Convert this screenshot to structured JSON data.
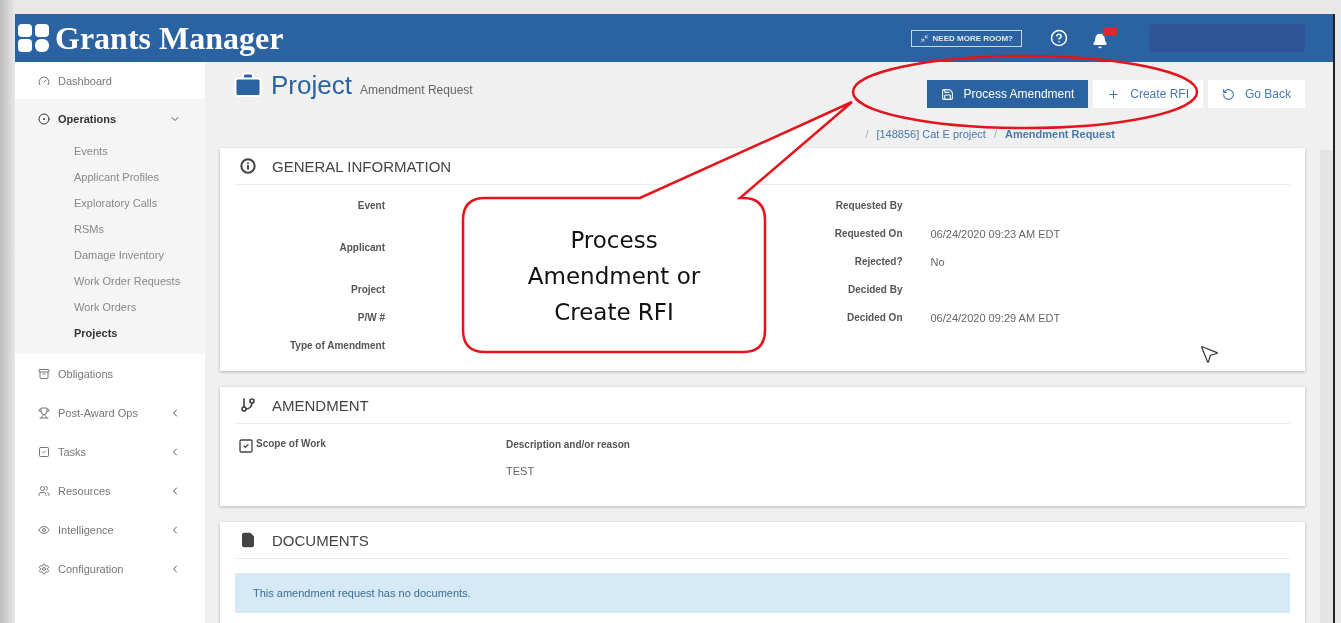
{
  "header": {
    "logo_text": "Grants Manager",
    "room_button": "NEED MORE ROOM?"
  },
  "sidebar": {
    "items": [
      {
        "label": "Dashboard",
        "selected": false
      },
      {
        "label": "Operations",
        "expanded": true,
        "selected": true,
        "children": [
          {
            "label": "Events",
            "selected": false
          },
          {
            "label": "Applicant Profiles",
            "selected": false
          },
          {
            "label": "Exploratory Calls",
            "selected": false
          },
          {
            "label": "RSMs",
            "selected": false
          },
          {
            "label": "Damage Inventory",
            "selected": false
          },
          {
            "label": "Work Order Requests",
            "selected": false
          },
          {
            "label": "Work Orders",
            "selected": false
          },
          {
            "label": "Projects",
            "selected": true
          }
        ]
      },
      {
        "label": "Obligations",
        "selected": false
      },
      {
        "label": "Post-Award Ops",
        "expanded": false,
        "selected": false
      },
      {
        "label": "Tasks",
        "expanded": false,
        "selected": false
      },
      {
        "label": "Resources",
        "expanded": false,
        "selected": false
      },
      {
        "label": "Intelligence",
        "expanded": false,
        "selected": false
      },
      {
        "label": "Configuration",
        "expanded": false,
        "selected": false
      }
    ]
  },
  "page": {
    "title": "Project",
    "subtitle": "Amendment Request",
    "actions": [
      {
        "label": "Process Amendment",
        "kind": "primary"
      },
      {
        "label": "Create RFI",
        "kind": "plus"
      },
      {
        "label": "Go Back",
        "kind": "back"
      }
    ],
    "breadcrumb": [
      {
        "separator": "/",
        "label": "[148856] Cat E project",
        "selected": false
      },
      {
        "separator": "/",
        "label": "Amendment Request",
        "selected": true
      }
    ]
  },
  "general_information": {
    "title": "GENERAL INFORMATION",
    "left_fields": [
      {
        "label": "Event"
      },
      {
        "label": "Applicant"
      },
      {
        "label": "Project"
      },
      {
        "label": "P/W #"
      },
      {
        "label": "Type of Amendment"
      }
    ],
    "right_fields": [
      {
        "label": "Requested By"
      },
      {
        "label": "Requested On",
        "value": "06/24/2020 09:23 AM EDT"
      },
      {
        "label": "Rejected?",
        "value": "No"
      },
      {
        "label": "Decided By"
      },
      {
        "label": "Decided On",
        "value": "06/24/2020 09:29 AM EDT"
      }
    ]
  },
  "amendment": {
    "title": "AMENDMENT",
    "scope": {
      "label": "Scope of Work",
      "checked": true
    },
    "description_label": "Description and/or reason",
    "description": "TEST"
  },
  "documents": {
    "title": "DOCUMENTS",
    "notice": "This amendment request has no documents."
  },
  "callout": {
    "text": "Process Amendment or Create RFI"
  }
}
